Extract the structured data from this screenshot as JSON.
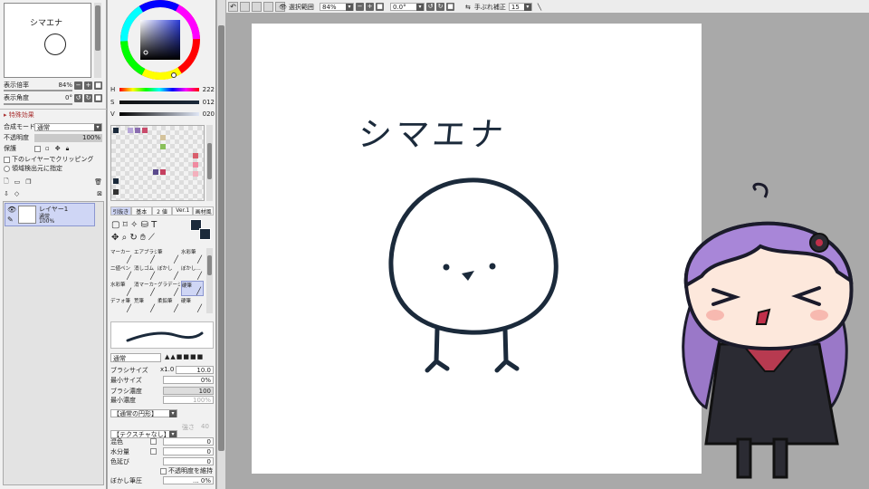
{
  "navigator": {
    "zoom_label": "表示倍率",
    "zoom_value": "84%",
    "angle_label": "表示角度",
    "angle_value": "0°",
    "thumb_title": "シマエナ"
  },
  "layer_props": {
    "effects_label": "▸ 特殊効果",
    "blend_label": "合成モード",
    "blend_value": "通常",
    "opacity_label": "不透明度",
    "opacity_value": "100%",
    "protect_label": "保護",
    "clip_label": "下のレイヤーでクリッピング",
    "detect_label": "領域検出元に指定"
  },
  "layer": {
    "name": "レイヤー1",
    "mode": "通常",
    "opacity": "100%"
  },
  "color": {
    "h_label": "H",
    "h_value": "222",
    "s_label": "S",
    "s_value": "012",
    "v_label": "V",
    "v_value": "020",
    "primary": "#1b2a3b"
  },
  "tool_tabs": [
    "引抜き",
    "基本",
    "2 値",
    "Ver.1",
    "画材風"
  ],
  "brushes": [
    [
      "マーカー",
      "エアブラシ",
      "筆",
      "水彩筆"
    ],
    [
      "二値ペン",
      "消しゴム",
      "ぼかし",
      "ぼかし..."
    ],
    [
      "水彩筆",
      "消マーカー",
      "グラデーション",
      "硬筆"
    ],
    [
      "デフォ筆",
      "荒筆",
      "柔鉛筆",
      "硬筆"
    ]
  ],
  "brush_opts": {
    "mode": "通常",
    "size_label": "ブラシサイズ",
    "size_mult": "x1.0",
    "size_value": "10.0",
    "min_size_label": "最小サイズ",
    "min_size_value": "0%",
    "density_label": "ブラシ濃度",
    "density_value": "100",
    "min_density_label": "最小濃度",
    "min_density_value": "100%",
    "shape": "【通常の円形】",
    "texture": "【テクスチャなし】",
    "texture_strength": "強さ",
    "texture_value": "40",
    "mix_label": "混色",
    "mix_value": "0",
    "water_label": "水分量",
    "water_value": "0",
    "extend_label": "色延び",
    "extend_value": "0",
    "keep_opacity_label": "不透明度を維持",
    "blur_label": "ぼかし筆圧",
    "blur_value": "... 0%"
  },
  "toolbar": {
    "select_label": "選択範囲",
    "zoom": "84%",
    "angle": "0.0°",
    "stabilizer_label": "手ぶれ補正",
    "stabilizer_value": "15"
  },
  "canvas": {
    "title_text": "シマエナ"
  },
  "colors": {
    "bg": "#a9a9a9",
    "panel": "#f1f1f1",
    "selected": "#cfd6f5",
    "accent": "#1b2a3b"
  }
}
